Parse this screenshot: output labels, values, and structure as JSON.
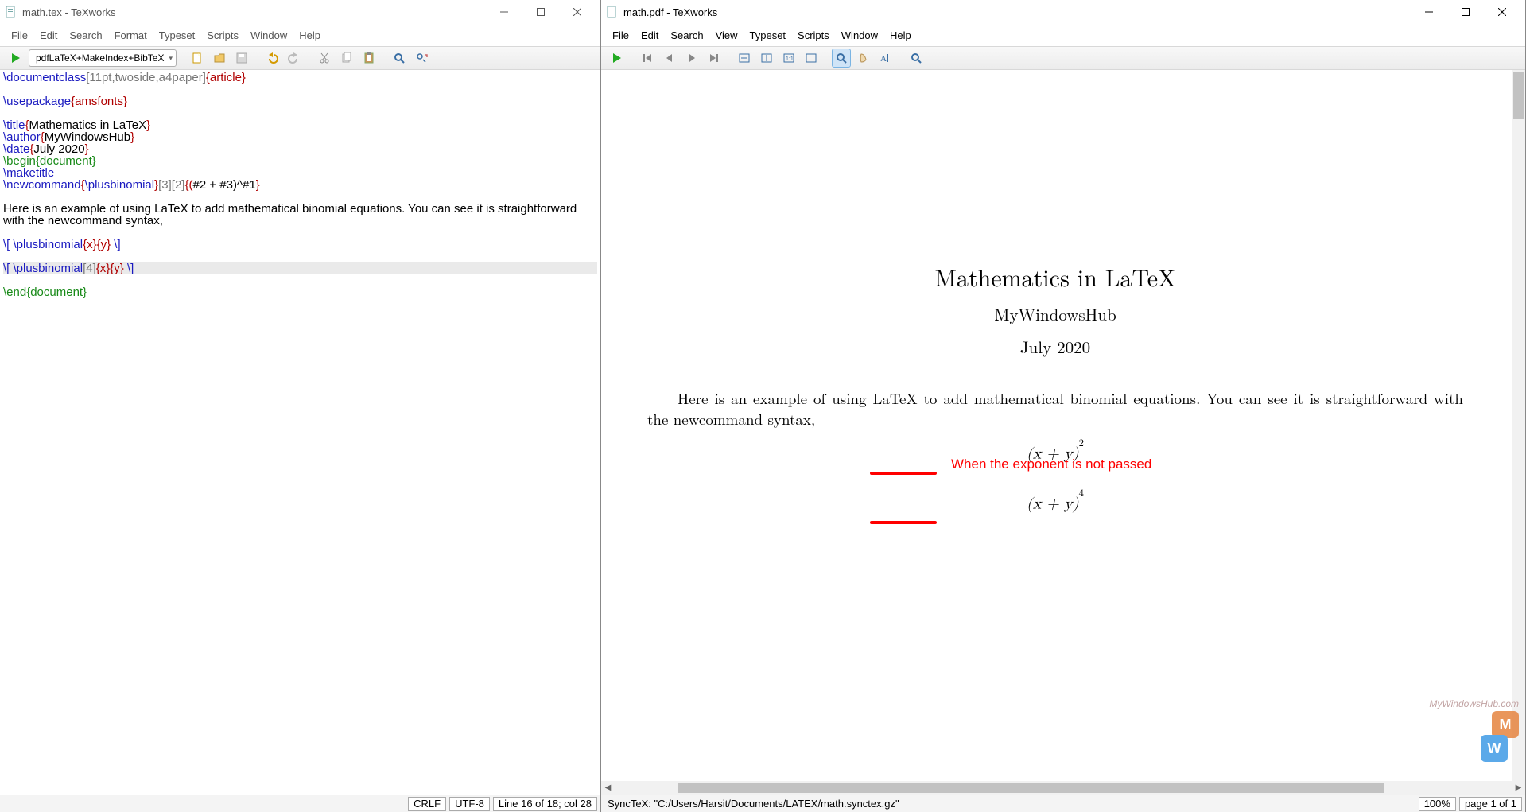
{
  "left": {
    "title": "math.tex - TeXworks",
    "menu": [
      "File",
      "Edit",
      "Search",
      "Format",
      "Typeset",
      "Scripts",
      "Window",
      "Help"
    ],
    "typeset_combo": "pdfLaTeX+MakeIndex+BibTeX",
    "status": {
      "eol": "CRLF",
      "enc": "UTF-8",
      "pos": "Line 16 of 18; col 28"
    },
    "code": {
      "l1_cmd": "\\documentclass",
      "l1_opt": "[11pt,twoside,a4paper]",
      "l1_brace": "{article}",
      "l3_cmd": "\\usepackage",
      "l3_brace": "{amsfonts}",
      "l5_cmd": "\\title",
      "l5_b1": "{",
      "l5_txt": "Mathematics in LaTeX",
      "l5_b2": "}",
      "l6_cmd": "\\author",
      "l6_b1": "{",
      "l6_txt": "MyWindowsHub",
      "l6_b2": "}",
      "l7_cmd": "\\date",
      "l7_b1": "{",
      "l7_txt": "July 2020",
      "l7_b2": "}",
      "l8": "\\begin{document}",
      "l9": "\\maketitle",
      "l10_cmd": "\\newcommand",
      "l10_b1": "{",
      "l10_cmd2": "\\plusbinomial",
      "l10_b2": "}",
      "l10_opt": "[3][2]",
      "l10_b3": "{(",
      "l10_txt": "#2 + #3)^#1",
      "l10_b4": "}",
      "l12": "Here is an example of using LaTeX to add mathematical binomial equations. You can see it is straightforward with the newcommand syntax,",
      "l14_cmd": "\\[ \\plusbinomial",
      "l14_brace": "{x}{y}",
      "l14_cmd2": " \\]",
      "l16_cmd": "\\[ \\plusbinomial",
      "l16_opt": "[4]",
      "l16_brace": "{x}{y}",
      "l16_cmd2": " \\]",
      "l18": "\\end{document}"
    }
  },
  "right": {
    "title": "math.pdf - TeXworks",
    "menu": [
      "File",
      "Edit",
      "Search",
      "View",
      "Typeset",
      "Scripts",
      "Window",
      "Help"
    ],
    "status": {
      "synctex": "SyncTeX: \"C:/Users/Harsit/Documents/LATEX/math.synctex.gz\"",
      "zoom": "100%",
      "page": "page 1 of 1"
    },
    "pdf": {
      "title": "Mathematics in LaTeX",
      "author": "MyWindowsHub",
      "date": "July 2020",
      "body": "Here is an example of using LaTeX to add mathematical binomial equations. You can see it is straightforward with the newcommand syntax,",
      "annot": "When the exponent is not passed"
    }
  },
  "watermark": "MyWindowsHub.com"
}
